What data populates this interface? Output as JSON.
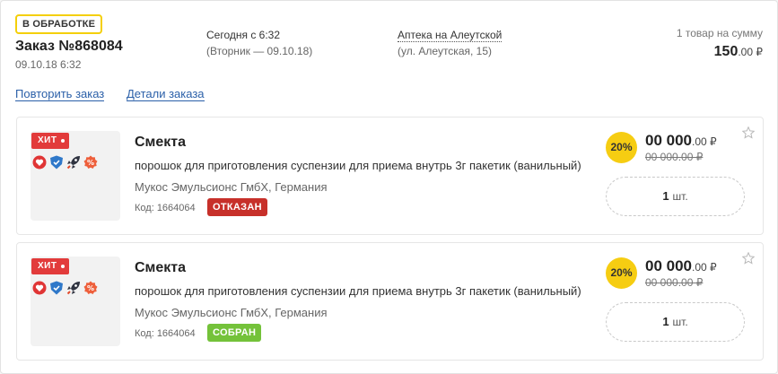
{
  "order": {
    "status": "В ОБРАБОТКЕ",
    "number": "Заказ №868084",
    "date": "09.10.18 6:32",
    "delivery": {
      "when": "Сегодня с 6:32",
      "day": "(Вторник — 09.10.18)"
    },
    "pharmacy": {
      "name": "Аптека на Алеутской",
      "address": "(ул. Алеутская, 15)"
    },
    "summary": {
      "label": "1 товар на сумму",
      "total": "150",
      "total_dec": ".00 ₽"
    },
    "actions": {
      "repeat": "Повторить заказ",
      "details": "Детали заказа"
    }
  },
  "items": [
    {
      "tag": "ХИТ",
      "name": "Смекта",
      "description": "порошок для приготовления суспензии для приема внутрь 3г пакетик (ванильный)",
      "manufacturer": "Мукос Эмульсионс ГмбХ, Германия",
      "code": "Код: 1664064",
      "status": "ОТКАЗАН",
      "discount": "20%",
      "price": "00 000",
      "price_dec": ".00 ₽",
      "old_price": "00 000.00 ₽",
      "quantity": "1",
      "unit": "шт.",
      "badge_icons": [
        "heart-icon",
        "shield-icon",
        "rocket-icon",
        "percent-icon"
      ]
    },
    {
      "tag": "ХИТ",
      "name": "Смекта",
      "description": "порошок для приготовления суспензии для приема внутрь 3г пакетик (ванильный)",
      "manufacturer": "Мукос Эмульсионс ГмбХ, Германия",
      "code": "Код: 1664064",
      "status": "СОБРАН",
      "discount": "20%",
      "price": "00 000",
      "price_dec": ".00 ₽",
      "old_price": "00 000.00 ₽",
      "quantity": "1",
      "unit": "шт.",
      "badge_icons": [
        "heart-icon",
        "shield-icon",
        "rocket-icon",
        "percent-icon"
      ]
    }
  ],
  "colors": {
    "accent_yellow": "#f6cd12",
    "link_blue": "#2a5fa8",
    "refused_red": "#c7302a",
    "collected_green": "#74c23a",
    "hit_red": "#e23b3b"
  }
}
